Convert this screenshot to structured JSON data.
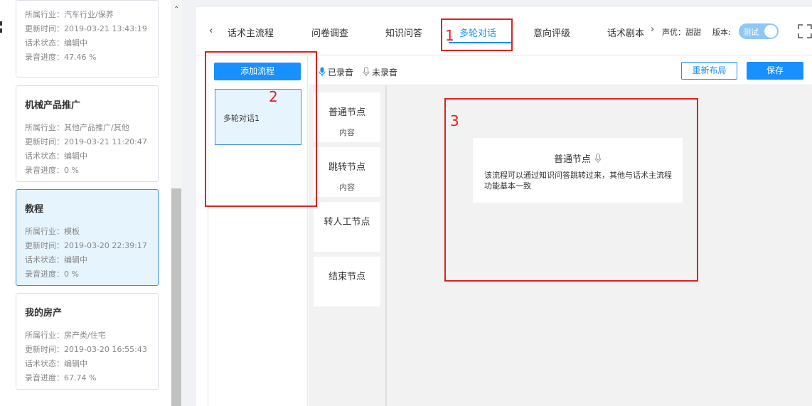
{
  "sidebar": {
    "field_labels": {
      "industry": "所属行业：",
      "updated": "更新时间：",
      "status": "话术状态：",
      "progress": "录音进度："
    },
    "cards": [
      {
        "title": "",
        "industry": "汽车行业/保养",
        "updated": "2019-03-21 13:43:19",
        "status": "编辑中",
        "progress": "47.46 %"
      },
      {
        "title": "机械产品推广",
        "industry": "其他产品推广/其他",
        "updated": "2019-03-21 11:20:47",
        "status": "编辑中",
        "progress": "0 %"
      },
      {
        "title": "教程",
        "industry": "模板",
        "updated": "2019-03-20 22:39:17",
        "status": "编辑中",
        "progress": "0 %"
      },
      {
        "title": "我的房产",
        "industry": "房产类/住宅",
        "updated": "2019-03-20 16:55:43",
        "status": "编辑中",
        "progress": "67.74 %"
      }
    ]
  },
  "tabs": [
    {
      "label": "话术主流程"
    },
    {
      "label": "问卷调查"
    },
    {
      "label": "知识问答"
    },
    {
      "label": "多轮对话"
    },
    {
      "label": "意向评级"
    },
    {
      "label": "话术剧本"
    }
  ],
  "active_tab": "多轮对话",
  "header": {
    "voice": "声优：甜甜",
    "version": "版本:",
    "version_toggle": "测试"
  },
  "annotations": [
    "1",
    "2",
    "3"
  ],
  "flow": {
    "add_button": "添加流程",
    "items": [
      "多轮对话1"
    ]
  },
  "toolbar": {
    "recorded": "已录音",
    "unrecorded": "未录音",
    "relayout": "重新布局",
    "save": "保存"
  },
  "palette": [
    {
      "title": "普通节点",
      "sub": "内容"
    },
    {
      "title": "跳转节点",
      "sub": "内容"
    },
    {
      "title": "转人工节点",
      "sub": ""
    },
    {
      "title": "结束节点",
      "sub": ""
    }
  ],
  "canvas": {
    "node": {
      "title": "普通节点",
      "description": "该流程可以通过知识问答跳转过来，其他与话术主流程功能基本一致"
    }
  },
  "colors": {
    "accent": "#1890ff",
    "annotation": "#e02020",
    "selected_bg": "#e6f4fd"
  }
}
